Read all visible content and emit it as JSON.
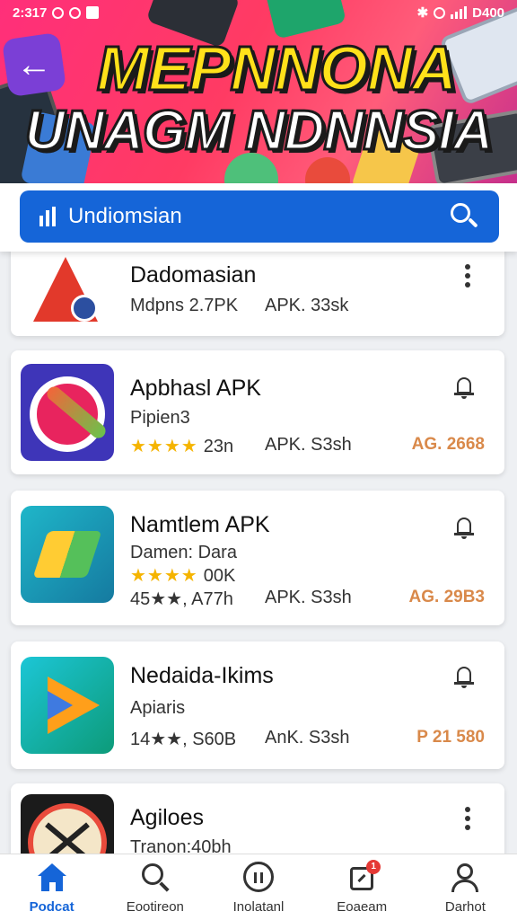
{
  "status_bar": {
    "time": "2:317",
    "battery": "D400"
  },
  "banner": {
    "title_line1": "MEPNNONA",
    "title_line2": "UNAGM NDNNSIA",
    "back_icon": "arrow-left-icon"
  },
  "search": {
    "placeholder": "Undiomsian"
  },
  "apps": [
    {
      "name": "Dadomasian",
      "line1": "Mdpns 2.7PK",
      "col2": "APK. 33sk",
      "col3": "",
      "action": "more-vert"
    },
    {
      "name": "Apbhasl APK",
      "line1": "Pipien3",
      "stars": "★★★★",
      "line2": "23n",
      "col2": "APK. S3sh",
      "col3": "AG. 2668",
      "action": "bell"
    },
    {
      "name": "Namtlem APK",
      "line1": "Damen: Dara",
      "stars": "★★★★",
      "line_mid": "00K",
      "line2": "45★★, A77h",
      "col2": "APK. S3sh",
      "col3": "AG. 29B3",
      "action": "bell"
    },
    {
      "name": "Nedaida-Ikims",
      "line1": "Apiaris",
      "line2": "14★★, S60B",
      "col2": "AnK. S3sh",
      "col3": "P 21 580",
      "action": "bell"
    },
    {
      "name": "Agiloes",
      "line1": "Tranon:40bh",
      "action": "more-vert"
    }
  ],
  "bottom_nav": [
    {
      "label": "Podcat",
      "icon": "home-icon",
      "active": true
    },
    {
      "label": "Eootireon",
      "icon": "search-icon",
      "active": false
    },
    {
      "label": "Inolatanl",
      "icon": "library-icon",
      "active": false
    },
    {
      "label": "Eoaeam",
      "icon": "updates-icon",
      "active": false,
      "badge": "1"
    },
    {
      "label": "Darhot",
      "icon": "account-icon",
      "active": false
    }
  ],
  "colors": {
    "accent": "#1565d8",
    "banner": "#ff2f7a",
    "star": "#f5b400",
    "price": "#d9894a"
  }
}
